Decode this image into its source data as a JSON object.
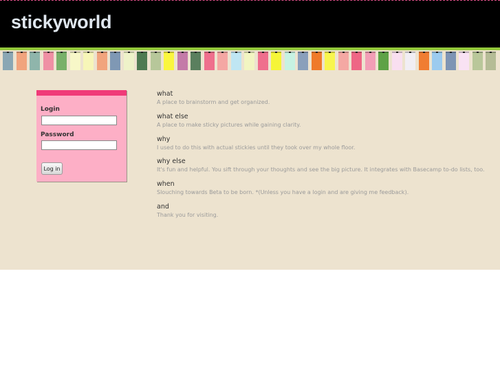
{
  "header": {
    "title": "stickyworld"
  },
  "colors": {
    "header_bg": "#000000",
    "accent_green": "#93c83a",
    "content_bg": "#ede3cf",
    "login_bg": "#fdafc6",
    "login_border": "#f03a78"
  },
  "stickies": [
    "#8aa7b4",
    "#f1a47d",
    "#8fb5ab",
    "#ef90a4",
    "#78b06a",
    "#f7f7c8",
    "#f7f6b8",
    "#f1a47d",
    "#7f98b4",
    "#eef2c9",
    "#4e7a52",
    "#b7c79a",
    "#faf63e",
    "#c47ba8",
    "#5a7f5e",
    "#ef6f8d",
    "#f4a7a3",
    "#bfe6f3",
    "#f2f5c2",
    "#ef6f8d",
    "#f5f537",
    "#c7f2e2",
    "#8a9fbb",
    "#ef7a2a",
    "#f8f54e",
    "#f4a8a3",
    "#ee6685",
    "#f29eb6",
    "#5ea246",
    "#f9dff0",
    "#f1eef4",
    "#f07d32",
    "#9ccbef",
    "#7e94b4",
    "#f9e2f3",
    "#b9c79a",
    "#b5bc96"
  ],
  "login": {
    "login_label": "Login",
    "login_value": "",
    "password_label": "Password",
    "password_value": "",
    "button_label": "Log in"
  },
  "info": [
    {
      "heading": "what",
      "text": "A place to brainstorm and get organized."
    },
    {
      "heading": "what else",
      "text": "A place to make sticky pictures while gaining clarity."
    },
    {
      "heading": "why",
      "text": "I used to do this with actual stickies until they took over my whole floor."
    },
    {
      "heading": "why else",
      "text": "It's fun and helpful. You sift through your thoughts and see the big picture. It integrates with Basecamp to-do lists, too."
    },
    {
      "heading": "when",
      "text": "Slouching towards Beta to be born. *(Unless you have a login and are giving me feedback)."
    },
    {
      "heading": "and",
      "text": "Thank you for visiting."
    }
  ]
}
